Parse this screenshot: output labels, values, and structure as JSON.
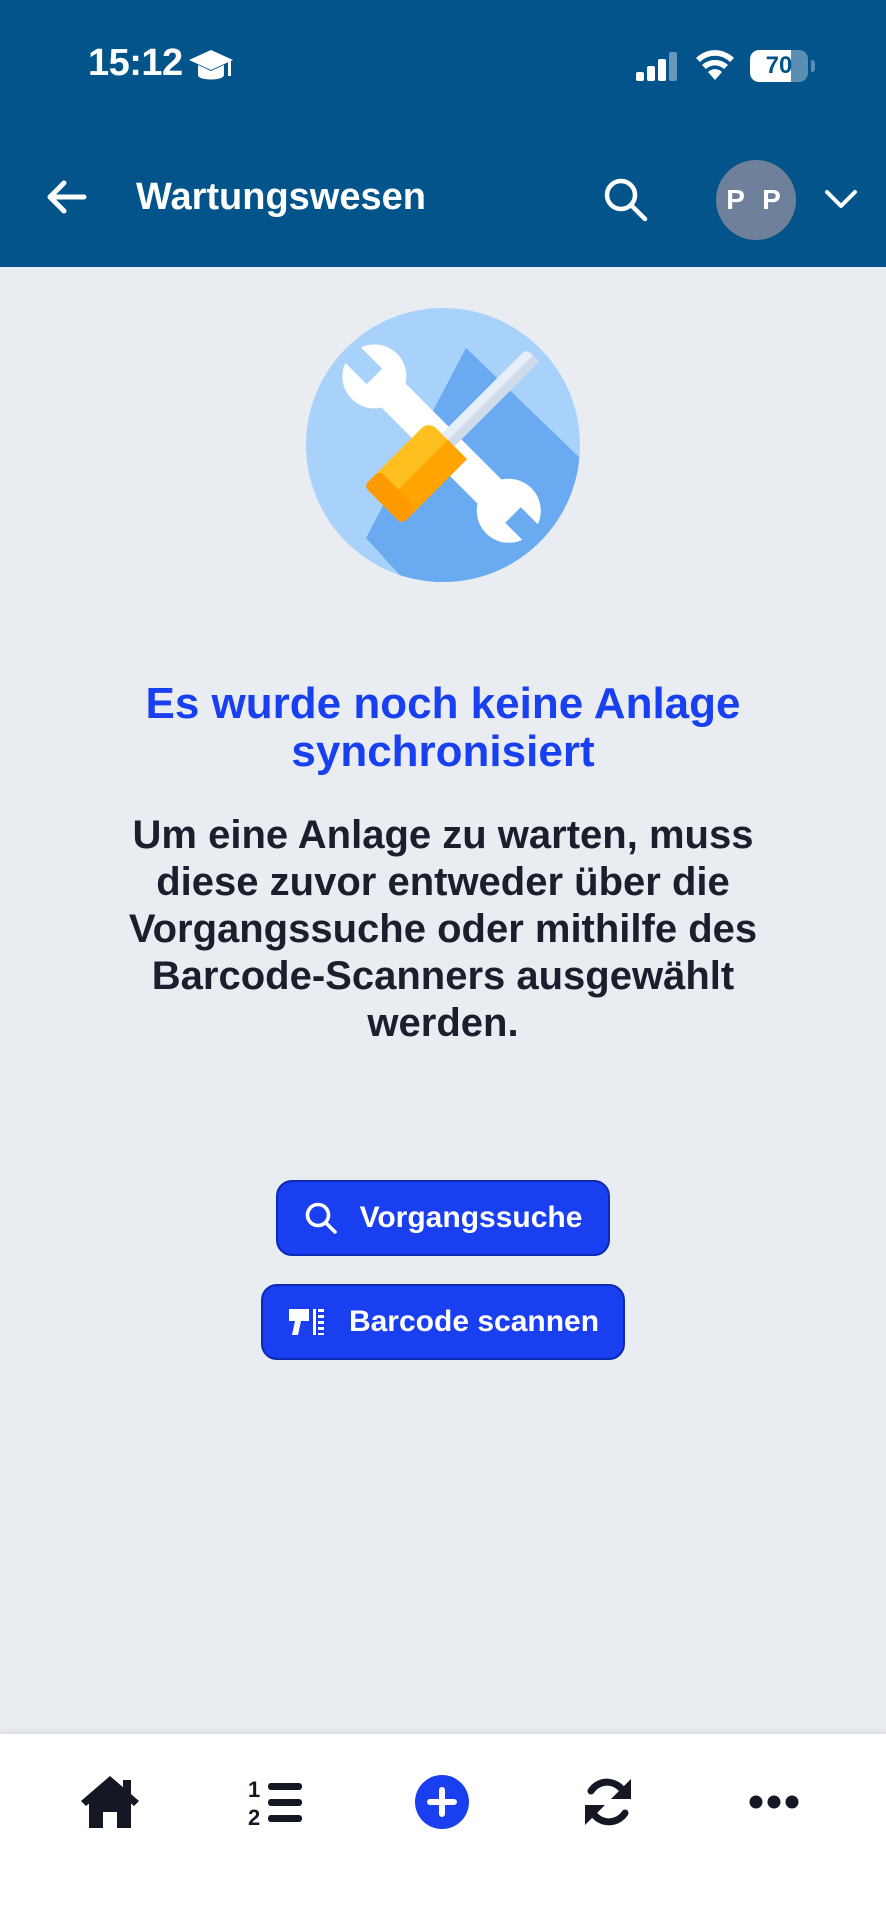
{
  "status_bar": {
    "time": "15:12",
    "battery": "70",
    "battery_level": 0.7,
    "icons": [
      "graduation-cap-icon",
      "cellular-signal-icon",
      "wifi-icon",
      "battery-icon"
    ]
  },
  "header": {
    "title": "Wartungswesen",
    "avatar_initials": "P P",
    "background": "#02548b",
    "icons": [
      "arrow-left-icon",
      "search-icon",
      "chevron-down-icon"
    ]
  },
  "empty_state": {
    "illustration": "wrench-screwdriver-icon",
    "title": "Es wurde noch keine Anlage synchronisiert",
    "description": "Um eine Anlage zu warten, muss diese zuvor entweder über die Vorgangssuche oder mithilfe des Barcode-Scanners ausgewählt werden.",
    "title_color": "#1940f0"
  },
  "actions": {
    "search_label": "Vorgangssuche",
    "barcode_label": "Barcode scannen",
    "button_color": "#1a3ff0"
  },
  "bottom_nav": {
    "items": [
      "home-icon",
      "numbered-list-icon",
      "add-circle-icon",
      "sync-icon",
      "more-icon"
    ]
  }
}
